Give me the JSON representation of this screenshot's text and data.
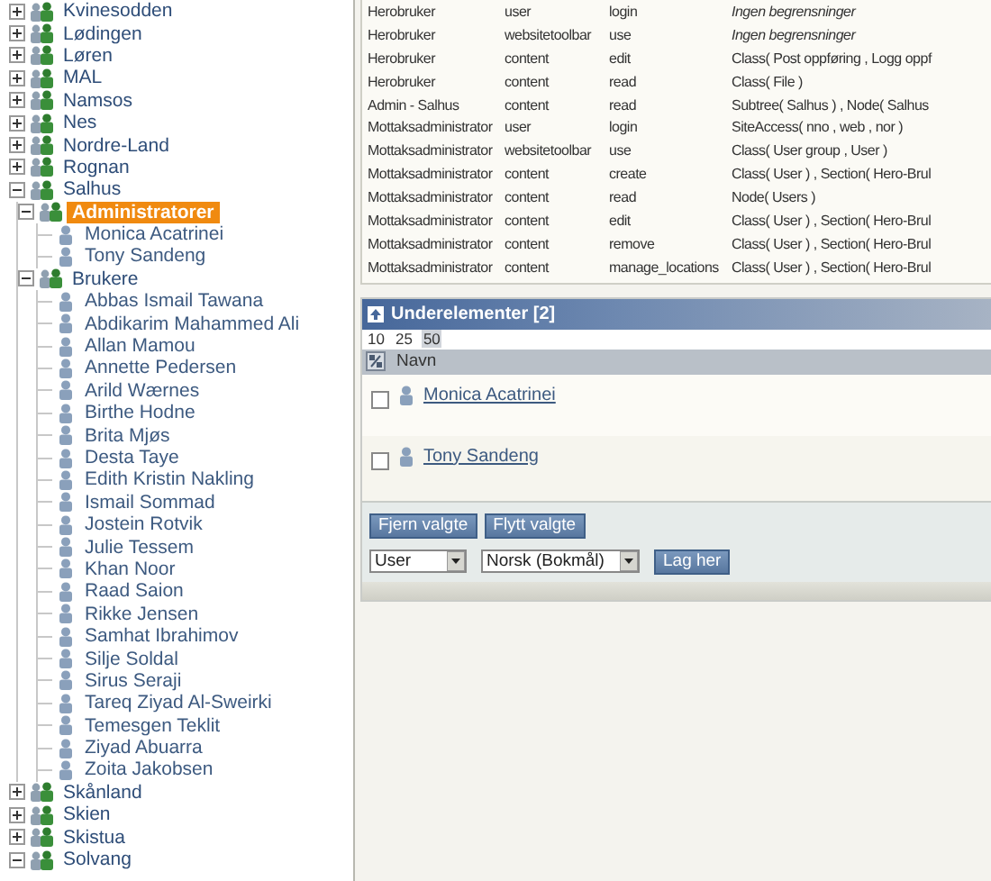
{
  "tree": [
    {
      "label": "Kvinesodden",
      "kind": "group",
      "expanded": false,
      "selected": false
    },
    {
      "label": "Lødingen",
      "kind": "group",
      "expanded": false,
      "selected": false
    },
    {
      "label": "Løren",
      "kind": "group",
      "expanded": false,
      "selected": false
    },
    {
      "label": "MAL",
      "kind": "group",
      "expanded": false,
      "selected": false
    },
    {
      "label": "Namsos",
      "kind": "group",
      "expanded": false,
      "selected": false
    },
    {
      "label": "Nes",
      "kind": "group",
      "expanded": false,
      "selected": false
    },
    {
      "label": "Nordre-Land",
      "kind": "group",
      "expanded": false,
      "selected": false
    },
    {
      "label": "Rognan",
      "kind": "group",
      "expanded": false,
      "selected": false
    },
    {
      "label": "Salhus",
      "kind": "group",
      "expanded": true,
      "selected": false,
      "children": [
        {
          "label": "Administratorer",
          "kind": "group",
          "expanded": true,
          "selected": true,
          "children": [
            {
              "label": "Monica Acatrinei",
              "kind": "user",
              "selected": false
            },
            {
              "label": "Tony Sandeng",
              "kind": "user",
              "selected": false
            }
          ]
        },
        {
          "label": "Brukere",
          "kind": "group",
          "expanded": true,
          "selected": false,
          "children": [
            {
              "label": "Abbas Ismail Tawana",
              "kind": "user",
              "selected": false
            },
            {
              "label": "Abdikarim Mahammed Ali",
              "kind": "user",
              "selected": false
            },
            {
              "label": "Allan Mamou",
              "kind": "user",
              "selected": false
            },
            {
              "label": "Annette Pedersen",
              "kind": "user",
              "selected": false
            },
            {
              "label": "Arild Wærnes",
              "kind": "user",
              "selected": false
            },
            {
              "label": "Birthe Hodne",
              "kind": "user",
              "selected": false
            },
            {
              "label": "Brita Mjøs",
              "kind": "user",
              "selected": false
            },
            {
              "label": "Desta Taye",
              "kind": "user",
              "selected": false
            },
            {
              "label": "Edith Kristin Nakling",
              "kind": "user",
              "selected": false
            },
            {
              "label": "Ismail Sommad",
              "kind": "user",
              "selected": false
            },
            {
              "label": "Jostein Rotvik",
              "kind": "user",
              "selected": false
            },
            {
              "label": "Julie Tessem",
              "kind": "user",
              "selected": false
            },
            {
              "label": "Khan Noor",
              "kind": "user",
              "selected": false
            },
            {
              "label": "Raad Saion",
              "kind": "user",
              "selected": false
            },
            {
              "label": "Rikke Jensen",
              "kind": "user",
              "selected": false
            },
            {
              "label": "Samhat Ibrahimov",
              "kind": "user",
              "selected": false
            },
            {
              "label": "Silje Soldal",
              "kind": "user",
              "selected": false
            },
            {
              "label": "Sirus Seraji",
              "kind": "user",
              "selected": false
            },
            {
              "label": "Tareq Ziyad Al-Sweirki",
              "kind": "user",
              "selected": false
            },
            {
              "label": "Temesgen Teklit",
              "kind": "user",
              "selected": false
            },
            {
              "label": "Ziyad Abuarra",
              "kind": "user",
              "selected": false
            },
            {
              "label": "Zoita Jakobsen",
              "kind": "user",
              "selected": false
            }
          ]
        }
      ]
    },
    {
      "label": "Skånland",
      "kind": "group",
      "expanded": false,
      "selected": false
    },
    {
      "label": "Skien",
      "kind": "group",
      "expanded": false,
      "selected": false
    },
    {
      "label": "Skistua",
      "kind": "group",
      "expanded": false,
      "selected": false
    },
    {
      "label": "Solvang",
      "kind": "group",
      "expanded": true,
      "selected": false
    }
  ],
  "policies": [
    {
      "role": "Herobruker",
      "module": "user",
      "function": "login",
      "limitation": "Ingen begrensninger",
      "unrestricted": true
    },
    {
      "role": "Herobruker",
      "module": "websitetoolbar",
      "function": "use",
      "limitation": "Ingen begrensninger",
      "unrestricted": true
    },
    {
      "role": "Herobruker",
      "module": "content",
      "function": "edit",
      "limitation": "Class( Post oppføring , Logg oppf",
      "unrestricted": false
    },
    {
      "role": "Herobruker",
      "module": "content",
      "function": "read",
      "limitation": "Class( File )",
      "unrestricted": false
    },
    {
      "role": "Admin - Salhus",
      "module": "content",
      "function": "read",
      "limitation": "Subtree( Salhus ) , Node( Salhus",
      "unrestricted": false
    },
    {
      "role": "Mottaksadministrator",
      "module": "user",
      "function": "login",
      "limitation": "SiteAccess( nno , web , nor )",
      "unrestricted": false
    },
    {
      "role": "Mottaksadministrator",
      "module": "websitetoolbar",
      "function": "use",
      "limitation": "Class( User group , User )",
      "unrestricted": false
    },
    {
      "role": "Mottaksadministrator",
      "module": "content",
      "function": "create",
      "limitation": "Class( User ) , Section( Hero-Brul",
      "unrestricted": false
    },
    {
      "role": "Mottaksadministrator",
      "module": "content",
      "function": "read",
      "limitation": "Node( Users )",
      "unrestricted": false
    },
    {
      "role": "Mottaksadministrator",
      "module": "content",
      "function": "edit",
      "limitation": "Class( User ) , Section( Hero-Brul",
      "unrestricted": false
    },
    {
      "role": "Mottaksadministrator",
      "module": "content",
      "function": "remove",
      "limitation": "Class( User ) , Section( Hero-Brul",
      "unrestricted": false
    },
    {
      "role": "Mottaksadministrator",
      "module": "content",
      "function": "manage_locations",
      "limitation": "Class( User ) , Section( Hero-Brul",
      "unrestricted": false
    }
  ],
  "subitems": {
    "title": "Underelementer [2]",
    "page_sizes": [
      {
        "label": "10",
        "selected": false
      },
      {
        "label": "25",
        "selected": false
      },
      {
        "label": "50",
        "selected": true
      }
    ],
    "column": "Navn",
    "rows": [
      {
        "name": "Monica Acatrinei",
        "checked": false
      },
      {
        "name": "Tony Sandeng",
        "checked": false
      }
    ],
    "buttons": [
      "Fjern valgte",
      "Flytt valgte"
    ],
    "selects": [
      {
        "value": "User"
      },
      {
        "value": "Norsk (Bokmål)"
      }
    ],
    "create_button": "Lag her"
  }
}
